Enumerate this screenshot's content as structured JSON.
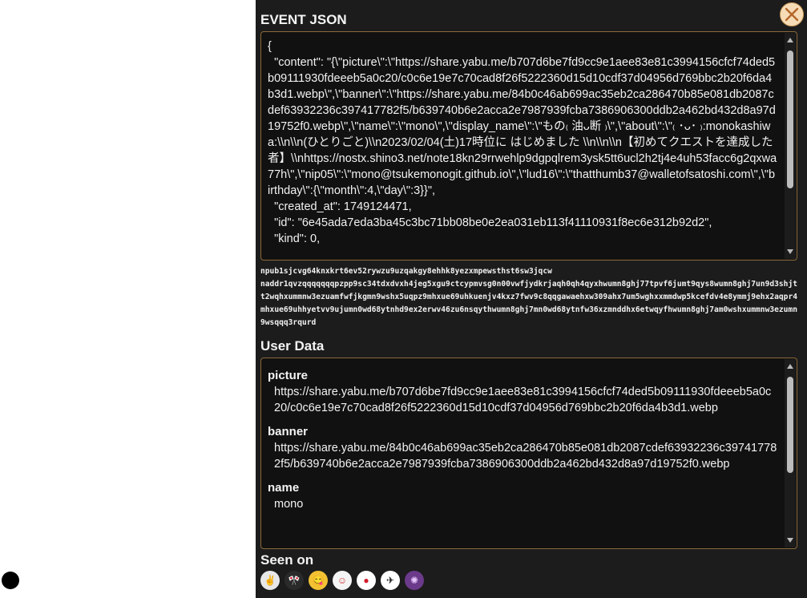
{
  "event_title": "EVENT JSON",
  "event_json_text": "{\n  \"content\": \"{\\\"picture\\\":\\\"https://share.yabu.me/b707d6be7fd9cc9e1aee83e81c3994156cfcf74ded5b09111930fdeeeb5a0c20/c0c6e19e7c70cad8f26f5222360d15d10cdf37d04956d769bbc2b20f6da4b3d1.webp\\\",\\\"banner\\\":\\\"https://share.yabu.me/84b0c46ab699ac35eb2ca286470b85e081db2087cdef63932236c397417782f5/b639740b6e2acca2e7987939fcba7386906300ddb2a462bd432d8a97d19752f0.webp\\\",\\\"name\\\":\\\"mono\\\",\\\"display_name\\\":\\\"もの₍ 油ᴗ断 ₎\\\",\\\"about\\\":\\\"₍ ･ᴗ･ ₎:monokashiwa:\\\\n\\\\n(ひとりごと)\\\\n2023/02/04(土)17時位に はじめました \\\\n\\\\n\\\\n【初めてクエストを達成した者】\\\\nhttps://nostx.shino3.net/note18kn29rrwehlp9dgpqlrem3ysk5tt6ucl2h2tj4e4uh53facc6g2qxwa77h\\\",\\\"nip05\\\":\\\"mono@tsukemonogit.github.io\\\",\\\"lud16\\\":\\\"thatthumb37@walletofsatoshi.com\\\",\\\"birthday\\\":{\\\"month\\\":4,\\\"day\\\":3}}\",\n  \"created_at\": 1749124471,\n  \"id\": \"6e45ada7eda3ba45c3bc71bb08be0e2ea031eb113f41110931f8ec6e312b92d2\",\n  \"kind\": 0,",
  "npub": "npub1sjcvg64knxkrt6ev52rywzu9uzqakgy8ehhk8yezxmpewsthst6sw3jqcw",
  "naddr": "naddr1qvzqqqqqqqpzpp9sc34tdxdvxh4jeg5xgu9ctcypmvsg0n00vwfjydkrjaqh0qh4qyxhwumn8ghj77tpvf6jumt9qys8wumn8ghj7un9d3shjtt2wqhxummnw3ezuamfwfjkgmn9wshx5uqpz9mhxue69uhkuenjv4kxz7fwv9c8qqgawaehxw309ahx7um5wghxxmmdwp5kcefdv4e8ymmj9ehx2aqpr4mhxue69uhhyetvv9ujumn0wd68ytnhd9ex2erwv46zu6nsqythwumn8ghj7mn0wd68ytnfw36xzmnddhx6etwqyfhwumn8ghj7am0wshxummnw3ezumn9wsqqq3rqurd",
  "user_title": "User Data",
  "user_fields": [
    {
      "key": "picture",
      "value": "https://share.yabu.me/b707d6be7fd9cc9e1aee83e81c3994156cfcf74ded5b09111930fdeeeb5a0c20/c0c6e19e7c70cad8f26f5222360d15d10cdf37d04956d769bbc2b20f6da4b3d1.webp"
    },
    {
      "key": "banner",
      "value": "https://share.yabu.me/84b0c46ab699ac35eb2ca286470b85e081db2087cdef63932236c397417782f5/b639740b6e2acca2e7987939fcba7386906300ddb2a462bd432d8a97d19752f0.webp"
    },
    {
      "key": "name",
      "value": "mono"
    }
  ],
  "seen_title": "Seen on",
  "relays": [
    {
      "icon": "relay-sign-icon",
      "glyph": "✌",
      "bg": "#e8e8e8",
      "fg": "#222"
    },
    {
      "icon": "relay-flags-icon",
      "glyph": "🎌",
      "bg": "#2a2a2a",
      "fg": "#fff"
    },
    {
      "icon": "relay-smile-icon",
      "glyph": "😋",
      "bg": "#f3c233",
      "fg": "#333"
    },
    {
      "icon": "relay-face-icon",
      "glyph": "☺",
      "bg": "#f4f4f4",
      "fg": "#c33"
    },
    {
      "icon": "relay-red-circle-icon",
      "glyph": "●",
      "bg": "#ffffff",
      "fg": "#d21a2a"
    },
    {
      "icon": "relay-bird-icon",
      "glyph": "✈",
      "bg": "#ffffff",
      "fg": "#111"
    },
    {
      "icon": "relay-purple-icon",
      "glyph": "✺",
      "bg": "#6b3a8a",
      "fg": "#e9c9ff"
    }
  ],
  "colors": {
    "panel_bg": "#1c1c1c",
    "box_border": "#8a6a3a",
    "close_bg": "#f6dcb6",
    "close_x": "#b4672a"
  }
}
